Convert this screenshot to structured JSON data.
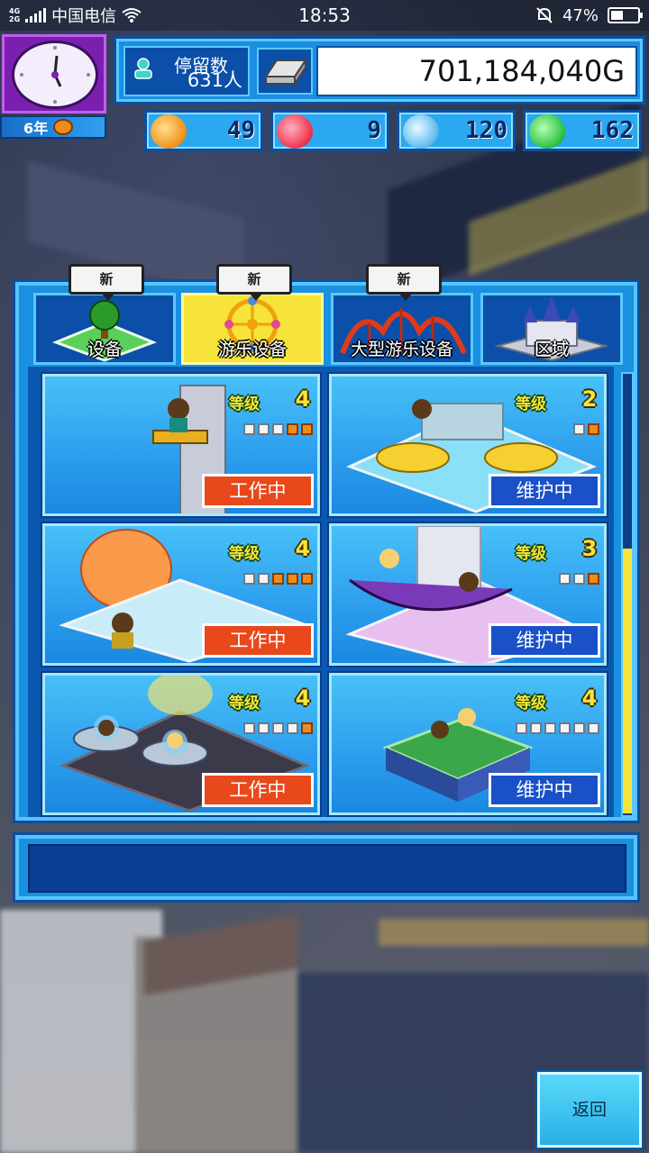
{
  "status_bar": {
    "network_types": [
      "4G",
      "2G"
    ],
    "carrier": "中国电信",
    "time": "18:53",
    "battery": "47%",
    "battery_level": 0.47
  },
  "hud": {
    "year_label": "6年",
    "visitors_label": "停留数",
    "visitors_count": "631人",
    "money": "701,184,040G",
    "resources": [
      {
        "icon": "orange-medal-icon",
        "value": "49"
      },
      {
        "icon": "red-flame-icon",
        "value": "9"
      },
      {
        "icon": "blue-drop-icon",
        "value": "120"
      },
      {
        "icon": "green-leaf-icon",
        "value": "162"
      }
    ]
  },
  "tabs": [
    {
      "label": "设备",
      "new_badge": "新",
      "icon": "tree-facility-icon",
      "active": false
    },
    {
      "label": "游乐设备",
      "new_badge": "新",
      "icon": "ferris-wheel-icon",
      "active": true
    },
    {
      "label": "大型游乐设备",
      "new_badge": "新",
      "icon": "roller-coaster-icon",
      "active": false
    },
    {
      "label": "区域",
      "new_badge": "",
      "icon": "castle-icon",
      "active": false
    }
  ],
  "rides": [
    {
      "level_label": "等级",
      "level": "4",
      "pips_total": 5,
      "pips_on": 2,
      "status": "工作中",
      "status_type": "working",
      "art": "tower-ride"
    },
    {
      "level_label": "等级",
      "level": "2",
      "pips_total": 2,
      "pips_on": 1,
      "status": "维护中",
      "status_type": "maint",
      "art": "swan-boat"
    },
    {
      "level_label": "等级",
      "level": "4",
      "pips_total": 5,
      "pips_on": 3,
      "status": "工作中",
      "status_type": "working",
      "art": "hot-air-balloon"
    },
    {
      "level_label": "等级",
      "level": "3",
      "pips_total": 3,
      "pips_on": 1,
      "status": "维护中",
      "status_type": "maint",
      "art": "pirate-ship"
    },
    {
      "level_label": "等级",
      "level": "4",
      "pips_total": 5,
      "pips_on": 1,
      "status": "工作中",
      "status_type": "working",
      "art": "ufo-ride"
    },
    {
      "level_label": "等级",
      "level": "4",
      "pips_total": 6,
      "pips_on": 0,
      "status": "维护中",
      "status_type": "maint",
      "art": "bumper-ring"
    }
  ],
  "scroll_position": 0.4,
  "message": "",
  "back_button": "返回",
  "colors": {
    "panel": "#1a90e0",
    "active_tab": "#f6e43a",
    "working": "#e8481a",
    "maintenance": "#1a50c8"
  }
}
